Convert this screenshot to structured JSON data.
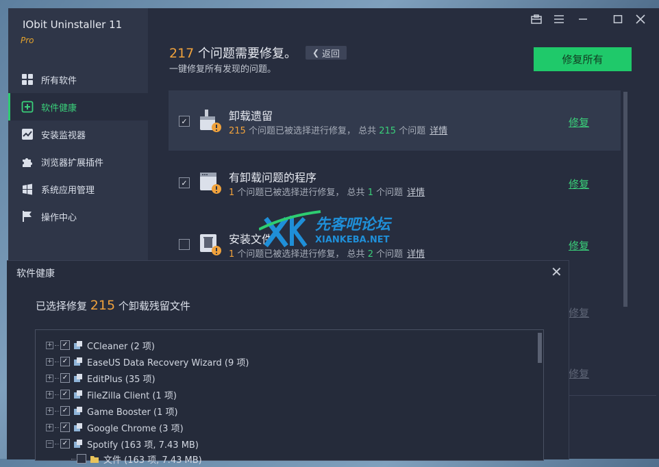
{
  "app": {
    "name": "IObit Uninstaller 11",
    "edition": "Pro"
  },
  "sidebar": {
    "items": [
      {
        "label": "所有软件",
        "icon": "grid-icon"
      },
      {
        "label": "软件健康",
        "icon": "health-plus-icon",
        "active": true
      },
      {
        "label": "安装监视器",
        "icon": "monitor-chart-icon"
      },
      {
        "label": "浏览器扩展插件",
        "icon": "puzzle-icon"
      },
      {
        "label": "系统应用管理",
        "icon": "windows-logo-icon"
      },
      {
        "label": "操作中心",
        "icon": "flag-icon"
      }
    ]
  },
  "titlebar": {
    "icons": [
      "toolbox-icon",
      "menu-icon",
      "minimize-icon",
      "maximize-icon",
      "close-icon"
    ]
  },
  "main": {
    "issue_count": "217",
    "heading_suffix": " 个问题需要修复。",
    "back_label": "返回",
    "subheading": "一键修复所有发现的问题。",
    "fix_all_label": "修复所有",
    "rows": [
      {
        "title": "卸载遗留",
        "selected_count": "215",
        "text_mid": " 个问题已被选择进行修复， 总共 ",
        "total_count": "215",
        "text_end": " 个问题",
        "detail_label": "详情",
        "fix_label": "修复",
        "checked": true
      },
      {
        "title": "有卸载问题的程序",
        "selected_count": "1",
        "text_mid": " 个问题已被选择进行修复， 总共 ",
        "total_count": "1",
        "text_end": " 个问题",
        "detail_label": "详情",
        "fix_label": "修复",
        "checked": true
      },
      {
        "title": "安装文件",
        "selected_count": "1",
        "text_mid": " 个问题已被选择进行修复， 总共 ",
        "total_count": "2",
        "text_end": " 个问题",
        "detail_label": "详情",
        "fix_label": "修复",
        "checked": false
      }
    ],
    "hidden_fix_labels": [
      "修复",
      "修复"
    ]
  },
  "dialog": {
    "title": "软件健康",
    "heading_prefix": "已选择修复 ",
    "heading_count": "215",
    "heading_suffix": " 个卸载残留文件",
    "tree": [
      {
        "label": "CCleaner (2 项)",
        "expander": "+"
      },
      {
        "label": "EaseUS Data Recovery Wizard (9 项)",
        "expander": "+"
      },
      {
        "label": "EditPlus (35 项)",
        "expander": "+"
      },
      {
        "label": "FileZilla Client (1 项)",
        "expander": "+"
      },
      {
        "label": "Game Booster (1 项)",
        "expander": "+"
      },
      {
        "label": "Google Chrome (3 项)",
        "expander": "+"
      },
      {
        "label": "Spotify (163 项, 7.43 MB)",
        "expander": "−"
      },
      {
        "label": "文件 (163 项, 7.43 MB)",
        "expander": ""
      }
    ]
  },
  "watermark": {
    "title": "先客吧论坛",
    "url": "XIANKEBA.NET"
  }
}
